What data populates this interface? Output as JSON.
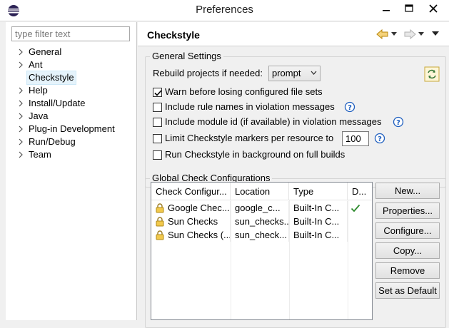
{
  "window": {
    "title": "Preferences"
  },
  "filter": {
    "placeholder": "type filter text"
  },
  "tree": [
    {
      "label": "General",
      "expandable": true
    },
    {
      "label": "Ant",
      "expandable": true
    },
    {
      "label": "Checkstyle",
      "expandable": false,
      "selected": true
    },
    {
      "label": "Help",
      "expandable": true
    },
    {
      "label": "Install/Update",
      "expandable": true
    },
    {
      "label": "Java",
      "expandable": true
    },
    {
      "label": "Plug-in Development",
      "expandable": true
    },
    {
      "label": "Run/Debug",
      "expandable": true
    },
    {
      "label": "Team",
      "expandable": true
    }
  ],
  "page": {
    "title": "Checkstyle"
  },
  "general_settings": {
    "legend": "General Settings",
    "rebuild_label": "Rebuild projects if needed:",
    "rebuild_value": "prompt",
    "options": [
      {
        "label": "Warn before losing configured file sets",
        "checked": true,
        "help": false
      },
      {
        "label": "Include rule names in violation messages",
        "checked": false,
        "help": true
      },
      {
        "label": "Include module id (if available) in violation messages",
        "checked": false,
        "help": true
      },
      {
        "label": "Limit Checkstyle markers per resource to",
        "checked": false,
        "help": true,
        "value": "100"
      },
      {
        "label": "Run Checkstyle in background on full builds",
        "checked": false,
        "help": false
      }
    ]
  },
  "global_configs": {
    "legend": "Global Check Configurations",
    "columns": [
      "Check Configur...",
      "Location",
      "Type",
      "D..."
    ],
    "rows": [
      {
        "name": "Google Chec...",
        "location": "google_c...",
        "type": "Built-In C...",
        "default": true
      },
      {
        "name": "Sun Checks",
        "location": "sun_checks...",
        "type": "Built-In C...",
        "default": false
      },
      {
        "name": "Sun Checks (...",
        "location": "sun_check...",
        "type": "Built-In C...",
        "default": false
      }
    ],
    "buttons": {
      "new": "New...",
      "properties": "Properties...",
      "configure": "Configure...",
      "copy": "Copy...",
      "remove": "Remove",
      "set_default": "Set as Default"
    }
  },
  "colors": {
    "check": "#2e8b2e",
    "selection": "#e5f3fb",
    "help": "#1f5fbf"
  }
}
